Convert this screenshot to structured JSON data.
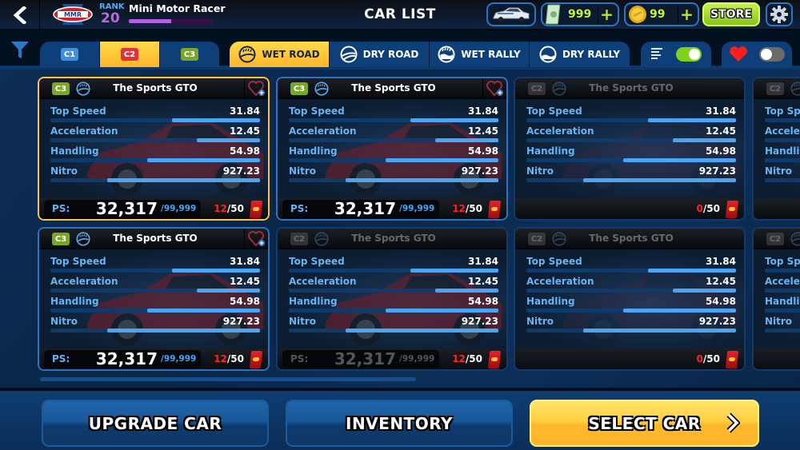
{
  "header": {
    "back_label": "Back",
    "logo_text": "MMR",
    "rank_label": "RANK",
    "rank_value": "20",
    "player_name": "Mini Motor Racer",
    "xp_progress": 0.5,
    "title": "CAR LIST",
    "cash": "999",
    "coins": "99",
    "store_label": "STORE"
  },
  "class_tabs": [
    {
      "label": "C1",
      "color": "#3f8fdb",
      "active": false
    },
    {
      "label": "C2",
      "color": "#e0323c",
      "active": true
    },
    {
      "label": "C3",
      "color": "#7aa72a",
      "active": false
    }
  ],
  "surface_tabs": [
    {
      "label": "WET ROAD",
      "active": true
    },
    {
      "label": "DRY ROAD",
      "active": false
    },
    {
      "label": "WET RALLY",
      "active": false
    },
    {
      "label": "DRY RALLY",
      "active": false
    }
  ],
  "toggles": {
    "sort_stats": true,
    "favorites_only": false
  },
  "stat_labels": [
    "Top Speed",
    "Acceleration",
    "Handling",
    "Nitro"
  ],
  "cards": [
    {
      "cls": "C3",
      "name": "The Sports GTO",
      "stats": [
        "31.84",
        "12.45",
        "54.98",
        "927.23"
      ],
      "fills": [
        0.42,
        0.3,
        0.54,
        0.73
      ],
      "ps": "32,317",
      "ps_max": "/99,999",
      "have": "12",
      "need": "/50",
      "state": "selected"
    },
    {
      "cls": "C3",
      "name": "The Sports GTO",
      "stats": [
        "31.84",
        "12.45",
        "54.98",
        "927.23"
      ],
      "fills": [
        0.42,
        0.3,
        0.54,
        0.73
      ],
      "ps": "32,317",
      "ps_max": "/99,999",
      "have": "12",
      "need": "/50",
      "state": "owned"
    },
    {
      "cls": "C2",
      "name": "The Sports GTO",
      "stats": [
        "31.84",
        "12.45",
        "54.98",
        "927.23"
      ],
      "fills": [
        0.42,
        0.3,
        0.54,
        0.73
      ],
      "ps": "",
      "ps_max": "",
      "have": "0",
      "need": "/50",
      "state": "locked"
    },
    {
      "cls": "C3",
      "name": "The Sports GTO",
      "stats": [
        "31.84",
        "12.45",
        "54.98",
        "927.23"
      ],
      "fills": [
        0.42,
        0.3,
        0.54,
        0.73
      ],
      "ps": "32,317",
      "ps_max": "/99,999",
      "have": "12",
      "need": "/50",
      "state": "owned"
    },
    {
      "cls": "C2",
      "name": "The Sports GTO",
      "stats": [
        "31.84",
        "12.45",
        "54.98",
        "927.23"
      ],
      "fills": [
        0.42,
        0.3,
        0.54,
        0.73
      ],
      "ps": "32,317",
      "ps_max": "/99,999",
      "have": "12",
      "need": "/50",
      "state": "locked-ps"
    },
    {
      "cls": "C2",
      "name": "The Sports GTO",
      "stats": [
        "31.84",
        "12.45",
        "54.98",
        "927.23"
      ],
      "fills": [
        0.42,
        0.3,
        0.54,
        0.73
      ],
      "ps": "",
      "ps_max": "",
      "have": "0",
      "need": "/50",
      "state": "locked"
    }
  ],
  "ps_label": "PS:",
  "scroll_position": 0.0,
  "buttons": {
    "upgrade": "UPGRADE CAR",
    "inventory": "INVENTORY",
    "select": "SELECT CAR"
  }
}
